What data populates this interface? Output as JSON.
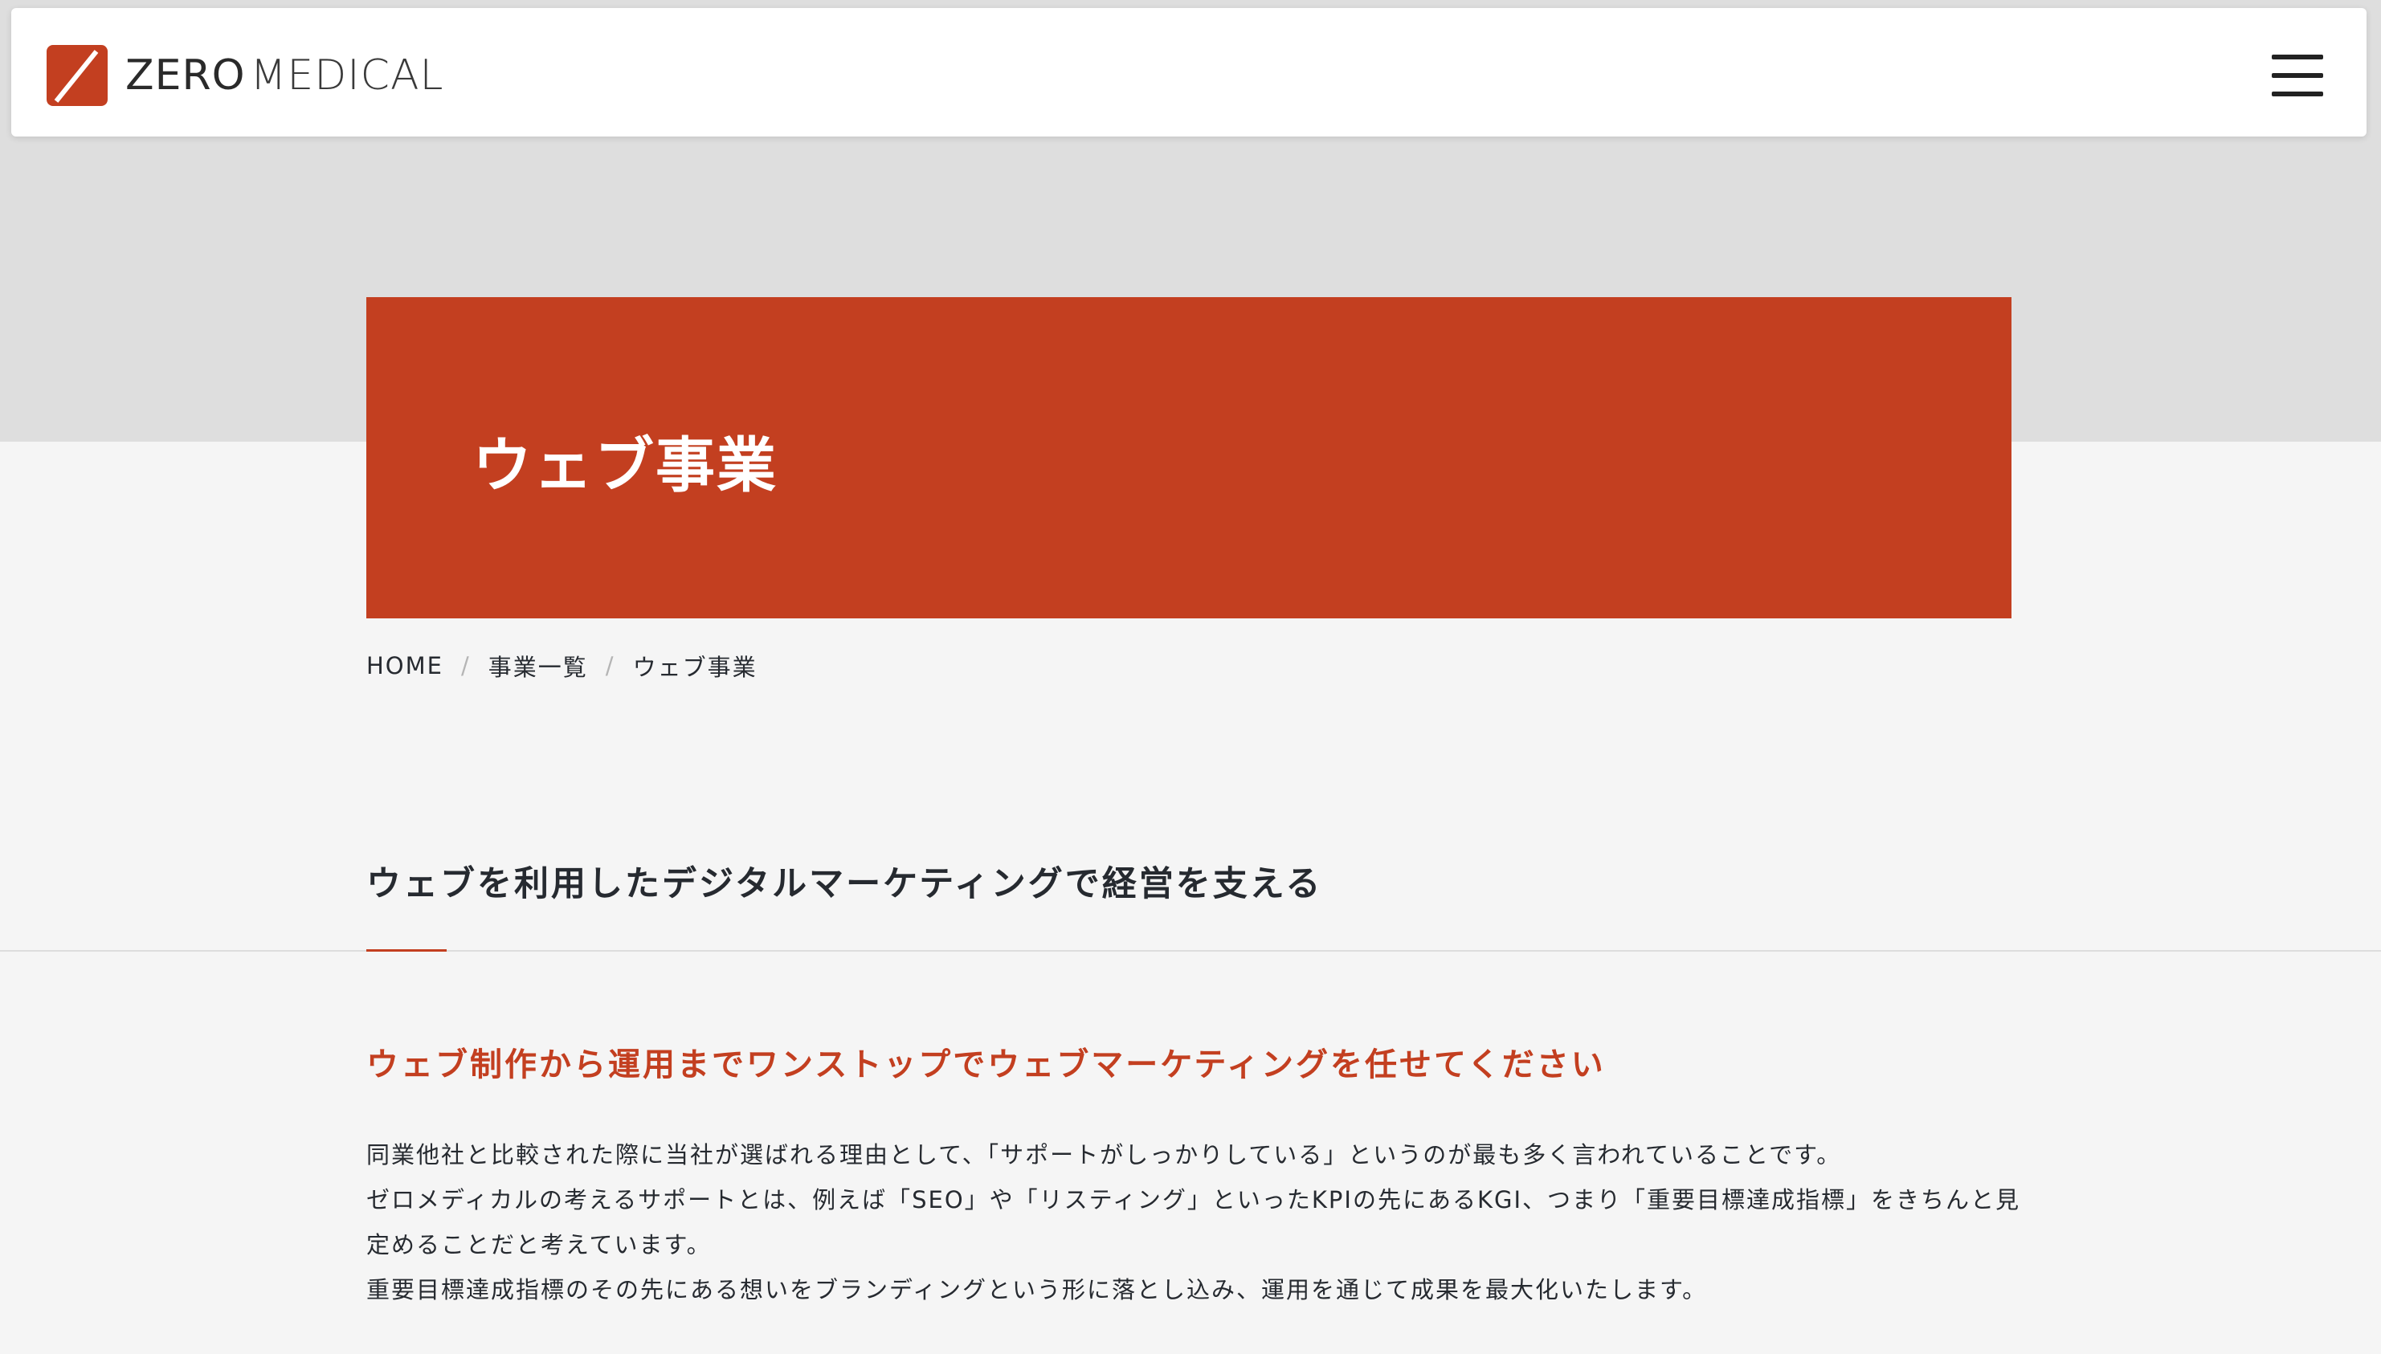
{
  "header": {
    "logo_word1": "ZERO",
    "logo_word2": "MEDICAL",
    "logo_mark_color": "#c33f20",
    "menu_icon": "hamburger-menu-icon"
  },
  "hero": {
    "title": "ウェブ事業",
    "color": "#c33f20"
  },
  "breadcrumb": {
    "items": [
      "HOME",
      "事業一覧",
      "ウェブ事業"
    ],
    "separator": "/"
  },
  "main": {
    "section_title": "ウェブを利用したデジタルマーケティングで経営を支える",
    "sub_title": "ウェブ制作から運用までワンストップでウェブマーケティングを任せてください",
    "paragraphs": [
      "同業他社と比較された際に当社が選ばれる理由として、「サポートがしっかりしている」というのが最も多く言われていることです。",
      "ゼロメディカルの考えるサポートとは、例えば「SEO」や「リスティング」といったKPIの先にあるKGI、つまり「重要目標達成指標」をきちんと見定めることだと考えています。",
      "重要目標達成指標のその先にある想いをブランディングという形に落とし込み、運用を通じて成果を最大化いたします。"
    ]
  }
}
